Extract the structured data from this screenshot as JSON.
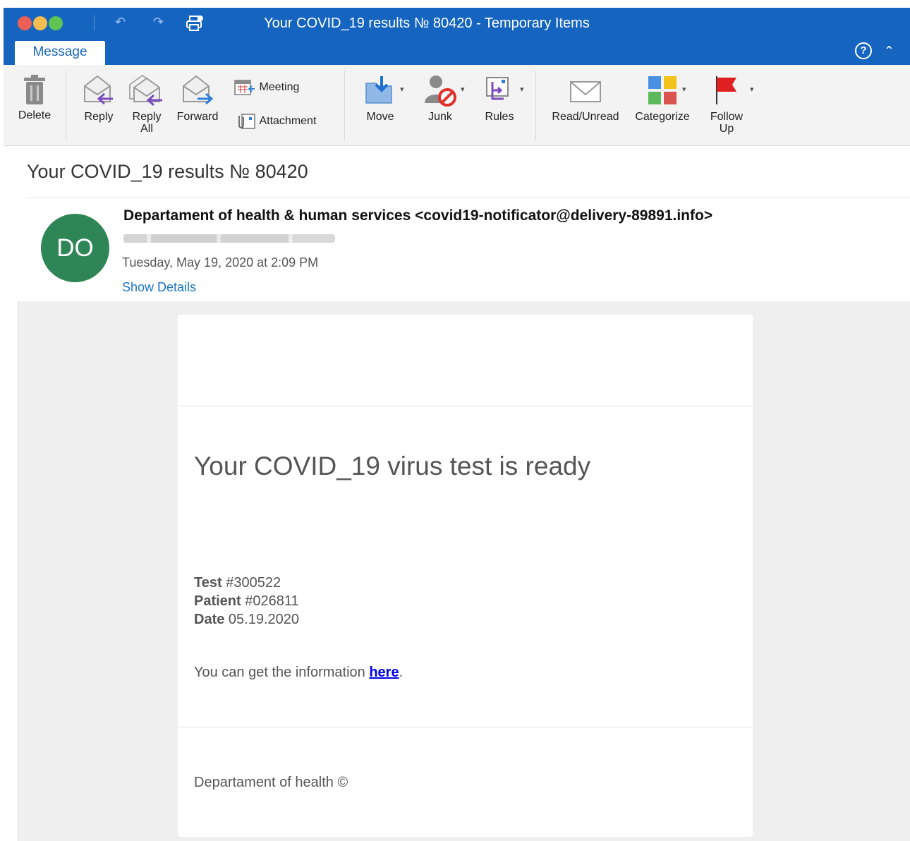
{
  "window": {
    "title": "Your COVID_19 results № 80420 - Temporary Items",
    "active_tab": "Message"
  },
  "ribbon": {
    "delete": "Delete",
    "reply": "Reply",
    "reply_all_1": "Reply",
    "reply_all_2": "All",
    "forward": "Forward",
    "meeting": "Meeting",
    "attachment": "Attachment",
    "move": "Move",
    "junk": "Junk",
    "rules": "Rules",
    "read_unread": "Read/Unread",
    "categorize": "Categorize",
    "follow_up_1": "Follow",
    "follow_up_2": "Up"
  },
  "email": {
    "subject": "Your COVID_19 results № 80420",
    "avatar_initials": "DO",
    "sender": "Departament of health & human services <covid19-notificator@delivery-89891.info>",
    "date": "Tuesday, May 19, 2020 at 2:09 PM",
    "show_details": "Show Details"
  },
  "message": {
    "heading": "Your COVID_19 virus test is ready",
    "test_label": "Test",
    "test_value": "#300522",
    "patient_label": "Patient",
    "patient_value": "#026811",
    "date_label": "Date",
    "date_value": "05.19.2020",
    "cta_text": "You can get the information",
    "cta_link": "here",
    "cta_end": ".",
    "footer": "Departament of health ©"
  },
  "colors": {
    "titlebar": "#1565c0",
    "avatar": "#2e8556",
    "link": "#1a73c9"
  }
}
